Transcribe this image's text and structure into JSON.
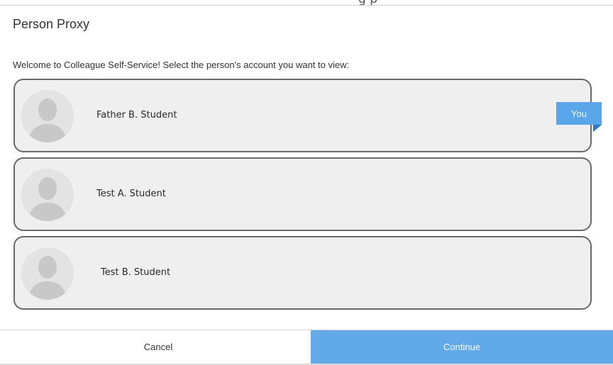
{
  "header": {
    "cut_off_text": "g      p",
    "title": "Person Proxy"
  },
  "welcome_text": "Welcome to Colleague Self-Service! Select the person's account you want to view:",
  "persons": [
    {
      "name": "Father B. Student",
      "is_you": true
    },
    {
      "name": "Test A. Student",
      "is_you": false
    },
    {
      "name": "Test B. Student",
      "is_you": false
    }
  ],
  "you_badge_label": "You",
  "footer": {
    "cancel_label": "Cancel",
    "continue_label": "Continue"
  },
  "colors": {
    "accent": "#62a9ea",
    "card_background": "#efefef",
    "card_border": "#6a6a6a"
  },
  "icons": {
    "avatar": "person-silhouette-icon"
  }
}
